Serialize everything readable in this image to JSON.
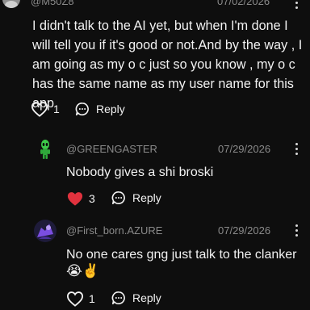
{
  "colors": {
    "background": "#0e0e0e",
    "text": "#f2f2f2",
    "muted": "#8a8a8a",
    "heart_active": "#e0323e"
  },
  "top_comment": {
    "username": "@M50Z8",
    "date": "07/02/2026",
    "text": "I didn't talk to the AI yet, but when I'm done I will tell you if it's good or not.And by the way , I am going as my o c just so you know , my o c has the same name as my user name for this app",
    "likes": "1",
    "reply_label": "Reply",
    "liked": false
  },
  "replies": [
    {
      "username": "@GREENGASTER",
      "date": "07/29/2026",
      "text": "Nobody gives a shi broski",
      "likes": "3",
      "reply_label": "Reply",
      "liked": true,
      "avatar_icon": "green-alien-icon"
    },
    {
      "username": "@First_born.AZURE",
      "date": "07/29/2026",
      "text": "No one cares gng just talk to the clanker",
      "emoji": "😭✌️",
      "likes": "1",
      "reply_label": "Reply",
      "liked": false,
      "avatar_icon": "purple-character-icon"
    }
  ]
}
